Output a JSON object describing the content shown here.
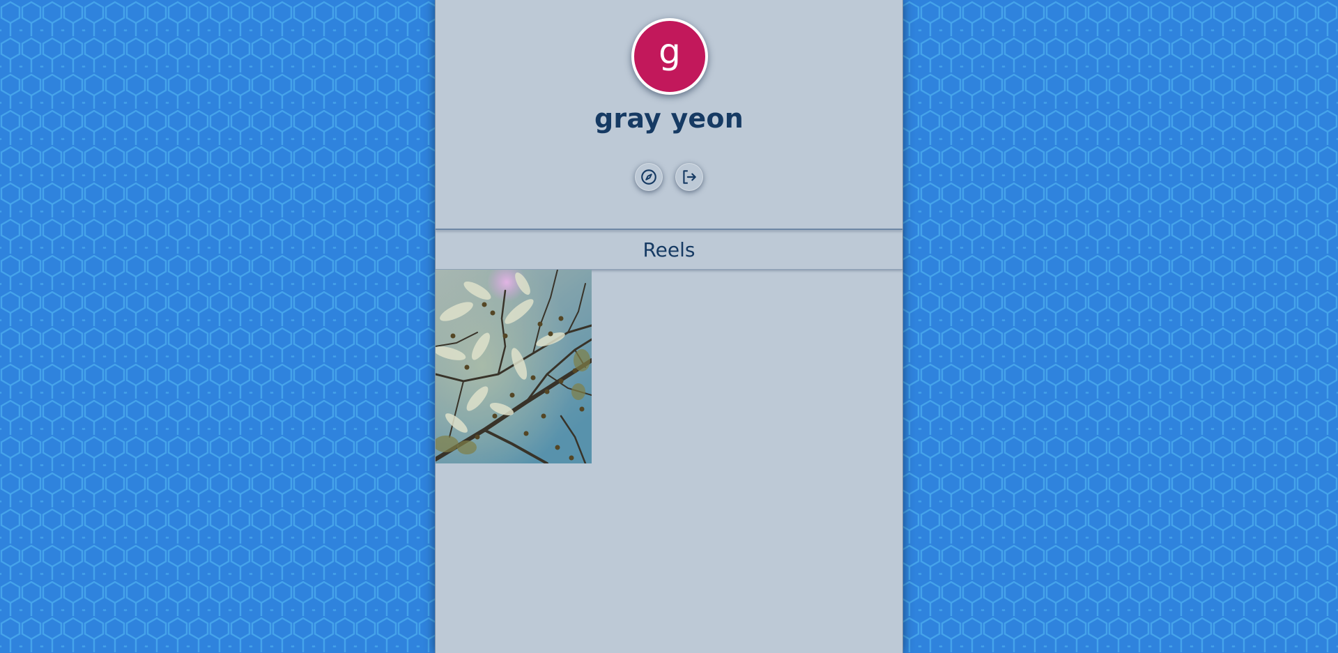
{
  "profile": {
    "avatar_letter": "g",
    "avatar_color": "#c2185b",
    "display_name": "gray yeon",
    "actions": [
      {
        "icon": "compass-icon"
      },
      {
        "icon": "logout-icon"
      }
    ]
  },
  "tabs": {
    "reels_label": "Reels"
  },
  "reels": [
    {
      "thumbnail": "tree-branches-sky"
    }
  ],
  "colors": {
    "background": "#2f83dd",
    "panel": "#bdc9d6",
    "text": "#163a63"
  }
}
